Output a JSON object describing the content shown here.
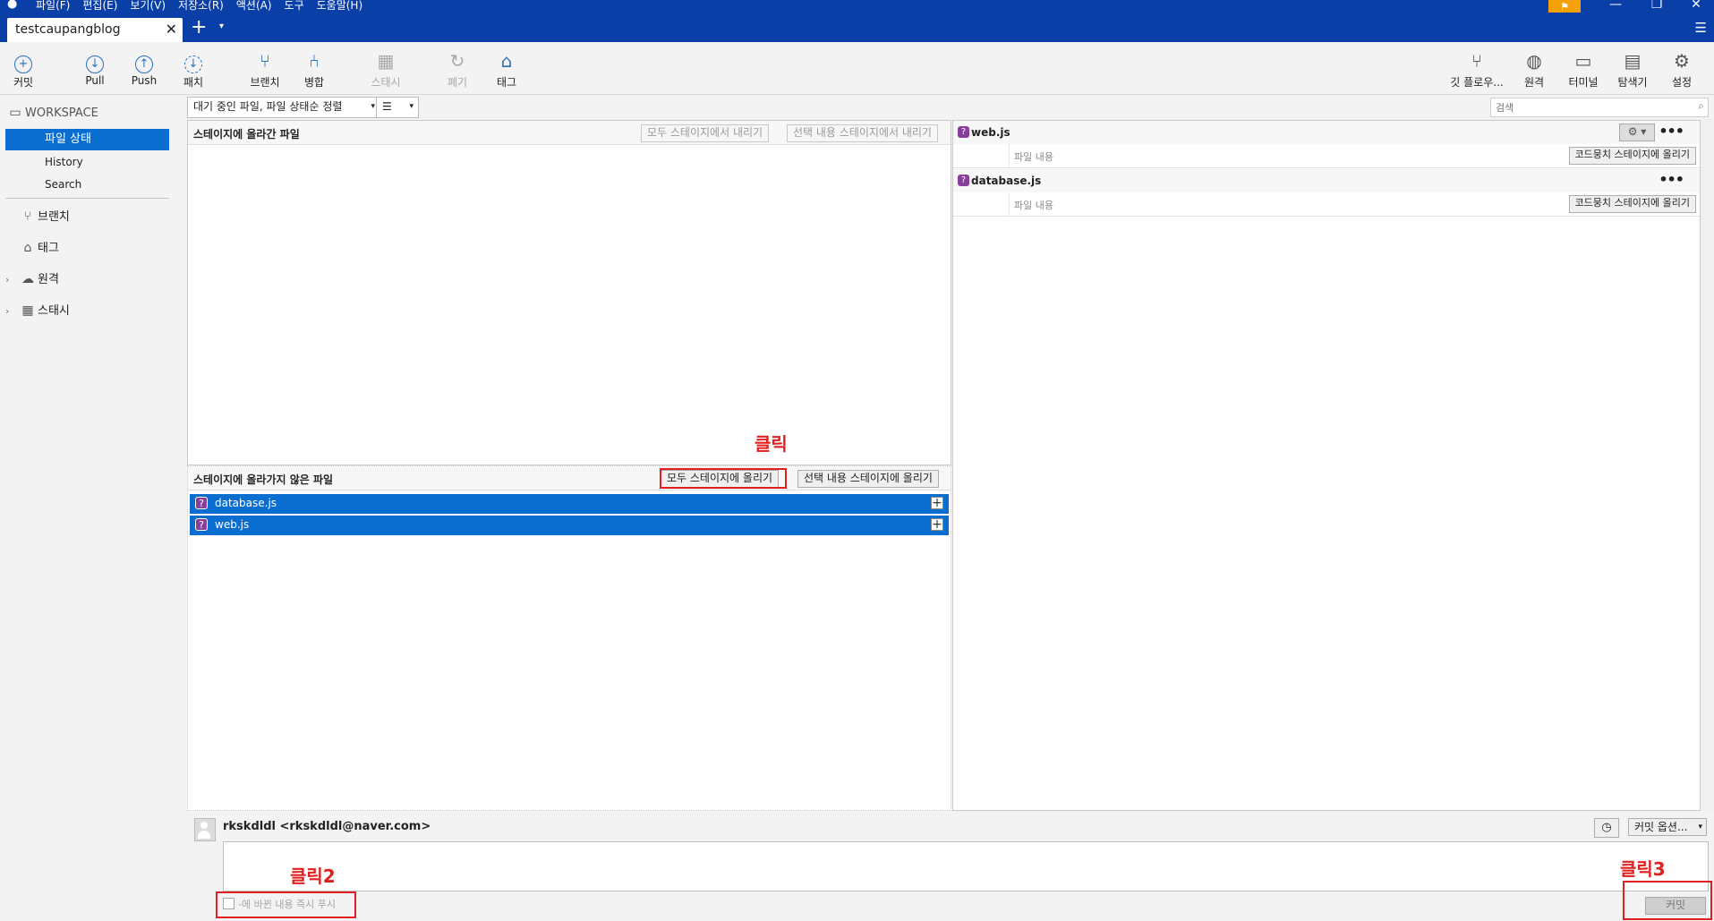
{
  "titlebar": {
    "menus": [
      "파일(F)",
      "편집(E)",
      "보기(V)",
      "저장소(R)",
      "액션(A)",
      "도구",
      "도움말(H)"
    ],
    "minimize": "—",
    "restore": "❐",
    "close": "✕"
  },
  "tabs": {
    "repo_name": "testcaupangblog",
    "close": "✕",
    "add": "+",
    "dropdown": "▾",
    "menu": "☰"
  },
  "toolbar": {
    "commit": "커밋",
    "pull": "Pull",
    "push": "Push",
    "fetch": "패치",
    "branch": "브랜치",
    "merge": "병합",
    "stash": "스태시",
    "discard": "폐기",
    "tag": "태그",
    "gitflow": "깃 플로우...",
    "remote": "원격",
    "terminal": "터미널",
    "explorer": "탐색기",
    "settings": "설정"
  },
  "sidebar": {
    "workspace": "WORKSPACE",
    "file_status": "파일 상태",
    "history": "History",
    "search": "Search",
    "branches": "브랜치",
    "tags": "태그",
    "remotes": "원격",
    "stashes": "스태시"
  },
  "filterbar": {
    "sort_label": "대기 중인 파일, 파일 상태순 정렬",
    "view_label": "☰",
    "search_placeholder": "검색"
  },
  "staged": {
    "title": "스테이지에 올라간 파일",
    "unstage_all": "모두 스테이지에서 내리기",
    "unstage_selected": "선택 내용 스테이지에서 내리기"
  },
  "unstaged": {
    "title": "스테이지에 올라가지 않은 파일",
    "stage_all": "모두 스테이지에 올리기",
    "stage_selected": "선택 내용 스테이지에 올리기",
    "files": [
      {
        "name": "database.js",
        "status": "?"
      },
      {
        "name": "web.js",
        "status": "?"
      }
    ]
  },
  "diff": {
    "files": [
      {
        "name": "web.js",
        "status": "?",
        "content_label": "파일 내용",
        "stage_hunk": "코드뭉치 스테이지에 올리기",
        "more": "•••"
      },
      {
        "name": "database.js",
        "status": "?",
        "content_label": "파일 내용",
        "stage_hunk": "코드뭉치 스테이지에 올리기",
        "more": "•••"
      }
    ]
  },
  "commit": {
    "author": "rkskdldl <rkskdldl@naver.com>",
    "options_label": "커밋 옵션...",
    "push_label": "-에 바뀐 내용 즉시 푸시",
    "commit_button": "커밋"
  },
  "annotations": {
    "click1": "클릭",
    "click2": "클릭2",
    "click3": "클릭3"
  },
  "colors": {
    "titlebar": "#0b3fa8",
    "selection": "#0a6ed1",
    "annotation": "#e02020",
    "untracked_badge": "#8a3e9c"
  }
}
